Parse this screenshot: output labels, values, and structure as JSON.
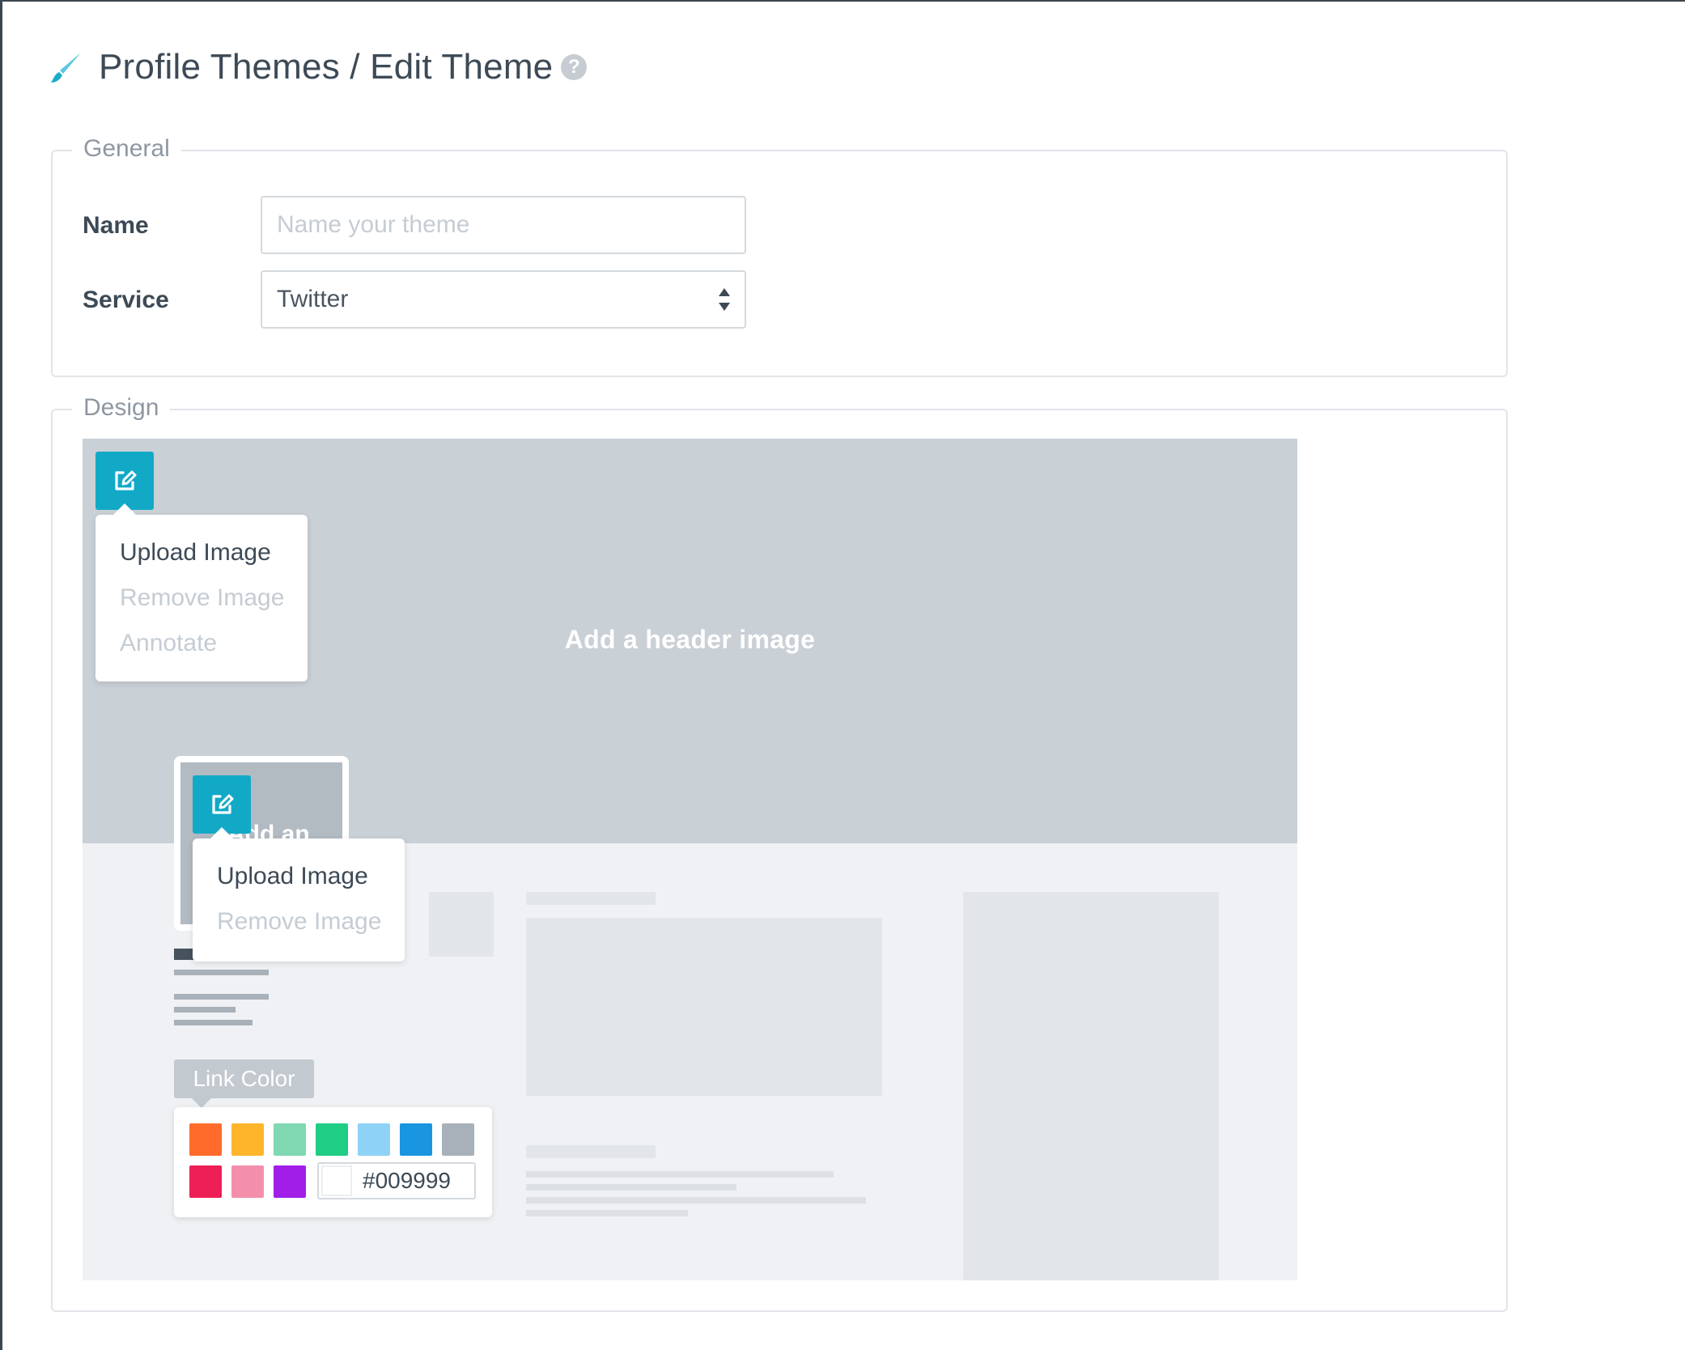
{
  "header": {
    "title": "Profile Themes / Edit Theme",
    "brush_icon": "brush-icon",
    "help_icon": "help-icon",
    "help_glyph": "?"
  },
  "general": {
    "legend": "General",
    "name_label": "Name",
    "name_placeholder": "Name your theme",
    "service_label": "Service",
    "service_value": "Twitter"
  },
  "design": {
    "legend": "Design",
    "header_prompt": "Add a header image",
    "header_menu": {
      "upload": "Upload Image",
      "remove": "Remove Image",
      "annotate": "Annotate"
    },
    "avatar_prompt": "Add an",
    "avatar_menu": {
      "upload": "Upload Image",
      "remove": "Remove Image"
    },
    "link_color_label": "Link Color",
    "link_color_value": "#009999",
    "swatches": [
      "#ff6b2b",
      "#fdb52b",
      "#7fd8b2",
      "#1fcd85",
      "#8fd2f7",
      "#1a95e0",
      "#a8b1b9",
      "#ee1f57",
      "#f48fab",
      "#a11ee8"
    ],
    "accent_color": "#12a9c7"
  }
}
